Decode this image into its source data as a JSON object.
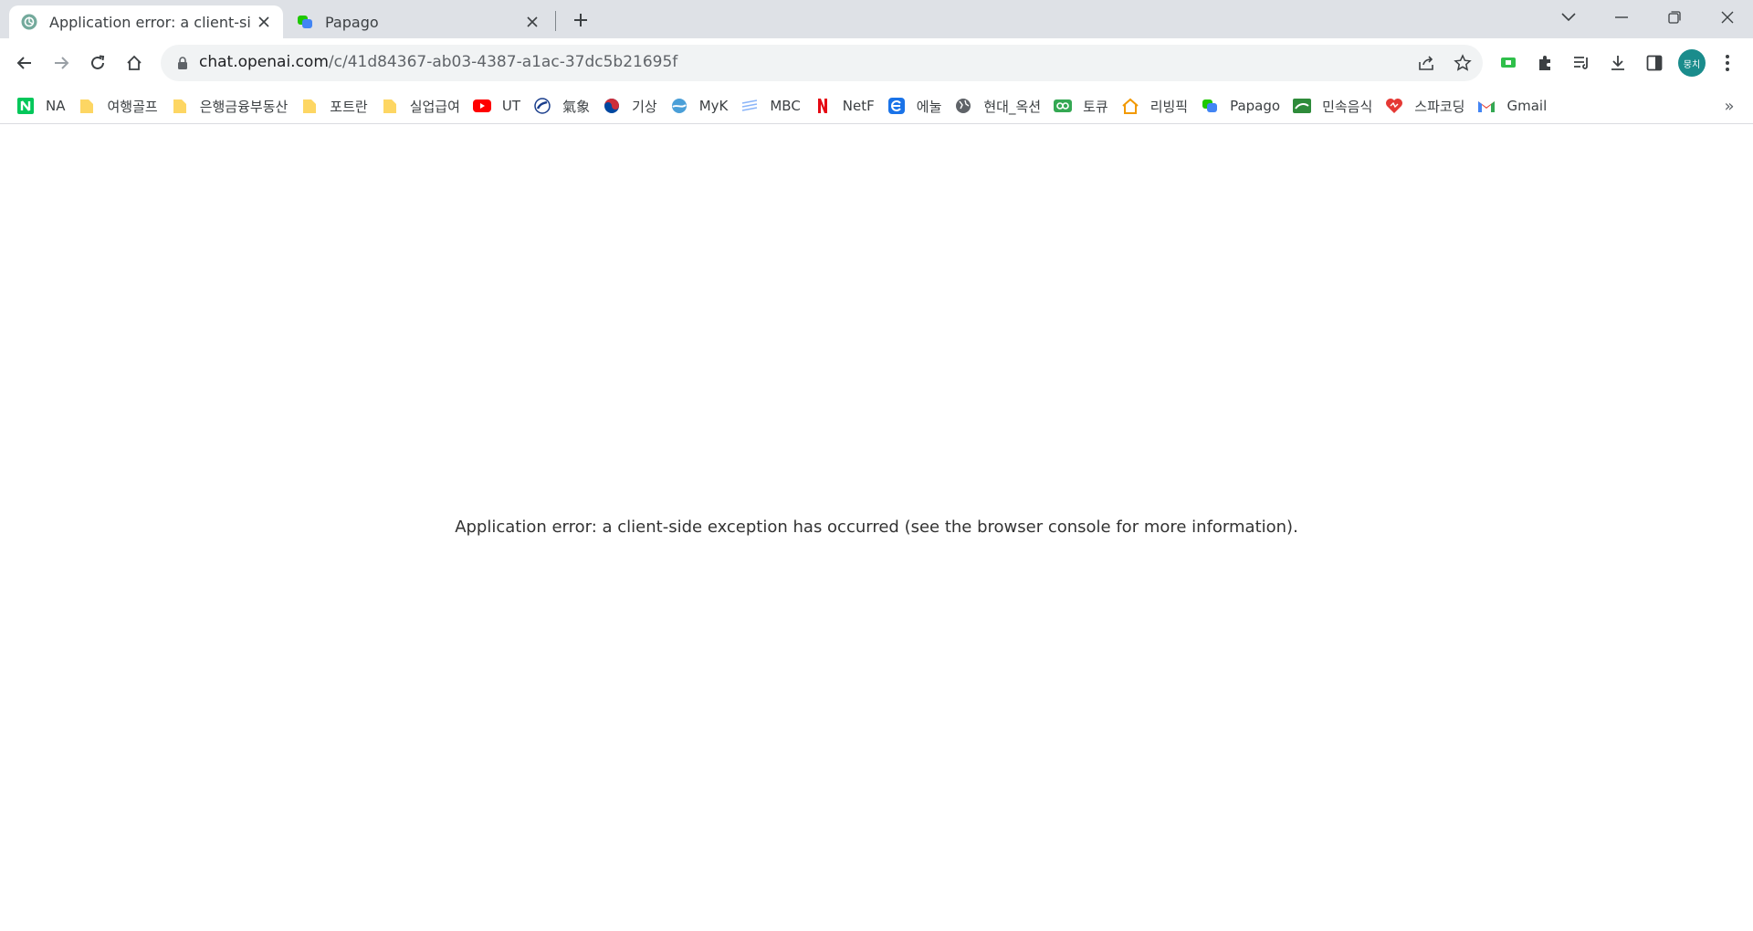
{
  "tabs": [
    {
      "title": "Application error: a client-side e",
      "favicon": "openai-icon",
      "active": true
    },
    {
      "title": "Papago",
      "favicon": "papago-icon",
      "active": false
    }
  ],
  "address_bar": {
    "host": "chat.openai.com",
    "path": "/c/41d84367-ab03-4387-a1ac-37dc5b21695f"
  },
  "profile": {
    "initials": "뭉치",
    "color": "#1a8c8c"
  },
  "bookmarks": [
    {
      "label": "NA",
      "icon": "naver-icon",
      "color": "#03c75a"
    },
    {
      "label": "여행골프",
      "icon": "folder-icon",
      "color": "#fdd663"
    },
    {
      "label": "은행금융부동산",
      "icon": "folder-icon",
      "color": "#fdd663"
    },
    {
      "label": "포트란",
      "icon": "folder-icon",
      "color": "#fdd663"
    },
    {
      "label": "실업급여",
      "icon": "folder-icon",
      "color": "#fdd663"
    },
    {
      "label": "UT",
      "icon": "youtube-icon",
      "color": "#ff0000"
    },
    {
      "label": "氣象",
      "icon": "weather-icon",
      "color": "#1a3e8c"
    },
    {
      "label": "기상",
      "icon": "korea-icon",
      "color": "#cd2e3a"
    },
    {
      "label": "MyK",
      "icon": "myk-icon",
      "color": "#4a9fd8"
    },
    {
      "label": "MBC",
      "icon": "mbc-icon",
      "color": "#8ab4f8"
    },
    {
      "label": "NetF",
      "icon": "netflix-icon",
      "color": "#e50914"
    },
    {
      "label": "에눌",
      "icon": "enuri-icon",
      "color": "#1a73e8"
    },
    {
      "label": "현대_옥션",
      "icon": "globe-icon",
      "color": "#5f6368"
    },
    {
      "label": "토큐",
      "icon": "toq-icon",
      "color": "#34a853"
    },
    {
      "label": "리빙픽",
      "icon": "house-icon",
      "color": "#f29900"
    },
    {
      "label": "Papago",
      "icon": "papago-icon",
      "color": "#1ec800"
    },
    {
      "label": "민속음식",
      "icon": "food-icon",
      "color": "#2e8b3a"
    },
    {
      "label": "스파코딩",
      "icon": "heart-icon",
      "color": "#e53935"
    },
    {
      "label": "Gmail",
      "icon": "gmail-icon",
      "color": "#ea4335"
    }
  ],
  "content": {
    "error_message": "Application error: a client-side exception has occurred (see the browser console for more information)."
  }
}
